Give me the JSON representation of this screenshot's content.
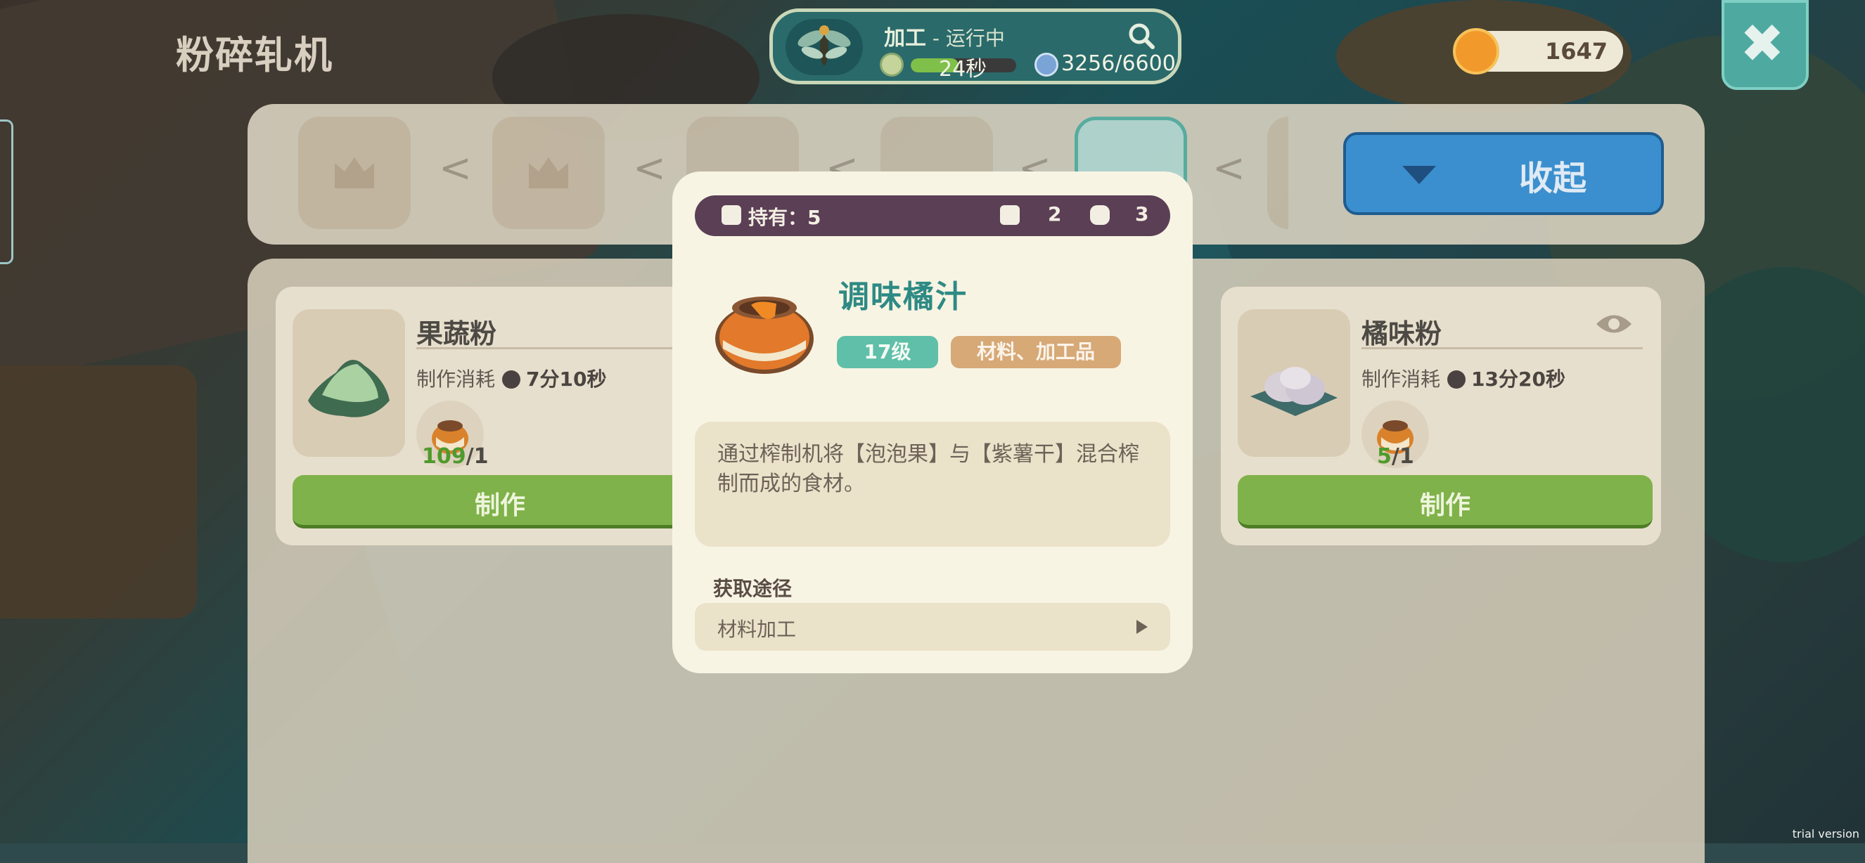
{
  "header": {
    "title": "粉碎轧机",
    "status_title": "加工",
    "status_sep": " - ",
    "status_sub": "运行中",
    "timer_text": "24秒",
    "timer_progress": 0.45,
    "capacity_text": "3256/6600",
    "coins": "1647"
  },
  "tabs": {
    "collapse_label": "收起",
    "arrow_glyph": "<"
  },
  "cards": [
    {
      "name": "果蔬粉",
      "cost_label": "制作消耗",
      "time": "7分10秒",
      "qty_have": "109",
      "qty_need": "/1",
      "make_label": "制作"
    },
    {
      "name": "橘味粉",
      "cost_label": "制作消耗",
      "time": "13分20秒",
      "qty_have": "5",
      "qty_need": "/1",
      "make_label": "制作"
    }
  ],
  "popup": {
    "owned_label": "持有：5",
    "count_a": "2",
    "count_b": "3",
    "item_name": "调味橘汁",
    "level": "17级",
    "category": "材料、加工品",
    "description": "通过榨制机将【泡泡果】与【紫薯干】混合榨制而成的食材。",
    "source_title": "获取途径",
    "source_item": "材料加工"
  },
  "watermark": "trial version",
  "colors": {
    "accent_teal": "#2e8a84",
    "make_green": "#7fb24a",
    "collapse_blue": "#3b8fce",
    "owned_bar": "#5a3f55"
  }
}
